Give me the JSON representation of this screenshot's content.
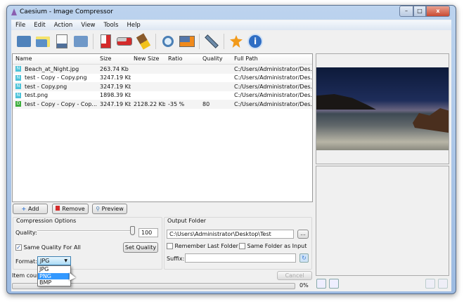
{
  "window": {
    "title": "Caesium - Image Compressor",
    "min": "–",
    "max": "□",
    "close": "x"
  },
  "menu": [
    "File",
    "Edit",
    "Action",
    "View",
    "Tools",
    "Help"
  ],
  "toolbar": [
    "open-files-icon",
    "open-folder-icon",
    "save-list-icon",
    "import-list-icon",
    "remove-item-icon",
    "clear-list-icon",
    "clean-icon",
    "preview-icon",
    "compress-icon",
    "settings-icon",
    "update-icon",
    "about-icon"
  ],
  "list": {
    "columns": [
      "Name",
      "Size",
      "New Size",
      "Ratio",
      "Quality",
      "Full Path"
    ],
    "rows": [
      {
        "badge": "N",
        "color": "#4cc3d9",
        "name": "Beach_at_Night.jpg",
        "size": "263.74 Kb",
        "new_size": "",
        "ratio": "",
        "quality": "",
        "path": "C:/Users/Administrator/Des..."
      },
      {
        "badge": "N",
        "color": "#4cc3d9",
        "name": "test - Copy - Copy.png",
        "size": "3247.19 Kb",
        "new_size": "",
        "ratio": "",
        "quality": "",
        "path": "C:/Users/Administrator/Des..."
      },
      {
        "badge": "N",
        "color": "#4cc3d9",
        "name": "test - Copy.png",
        "size": "3247.19 Kb",
        "new_size": "",
        "ratio": "",
        "quality": "",
        "path": "C:/Users/Administrator/Des..."
      },
      {
        "badge": "N",
        "color": "#4cc3d9",
        "name": "test.png",
        "size": "1898.39 Kb",
        "new_size": "",
        "ratio": "",
        "quality": "",
        "path": "C:/Users/Administrator/Des..."
      },
      {
        "badge": "D",
        "color": "#3cae3c",
        "name": "test - Copy - Copy - Cop...",
        "size": "3247.19 Kb",
        "new_size": "2128.22 Kb",
        "ratio": "-35 %",
        "quality": "80",
        "path": "C:/Users/Administrator/Des..."
      }
    ]
  },
  "buttons": {
    "add": "Add",
    "remove": "Remove",
    "preview": "Preview"
  },
  "compression": {
    "title": "Compression Options",
    "quality_label": "Quality:",
    "quality": "100",
    "quality_value": 100,
    "same_quality": "Same Quality For All",
    "set_quality": "Set Quality",
    "format_label": "Format:",
    "format": "JPG",
    "options": [
      "JPG",
      "PNG",
      "BMP"
    ]
  },
  "output": {
    "title": "Output Folder",
    "path": "C:\\Users\\Administrator\\Desktop\\Test",
    "browse": "...",
    "remember": "Remember Last Folder",
    "same_folder": "Same Folder as Input",
    "suffix_label": "Suffix:",
    "suffix": ""
  },
  "status": {
    "item_count": "Item count:",
    "cancel": "Cancel",
    "progress": "0%"
  }
}
